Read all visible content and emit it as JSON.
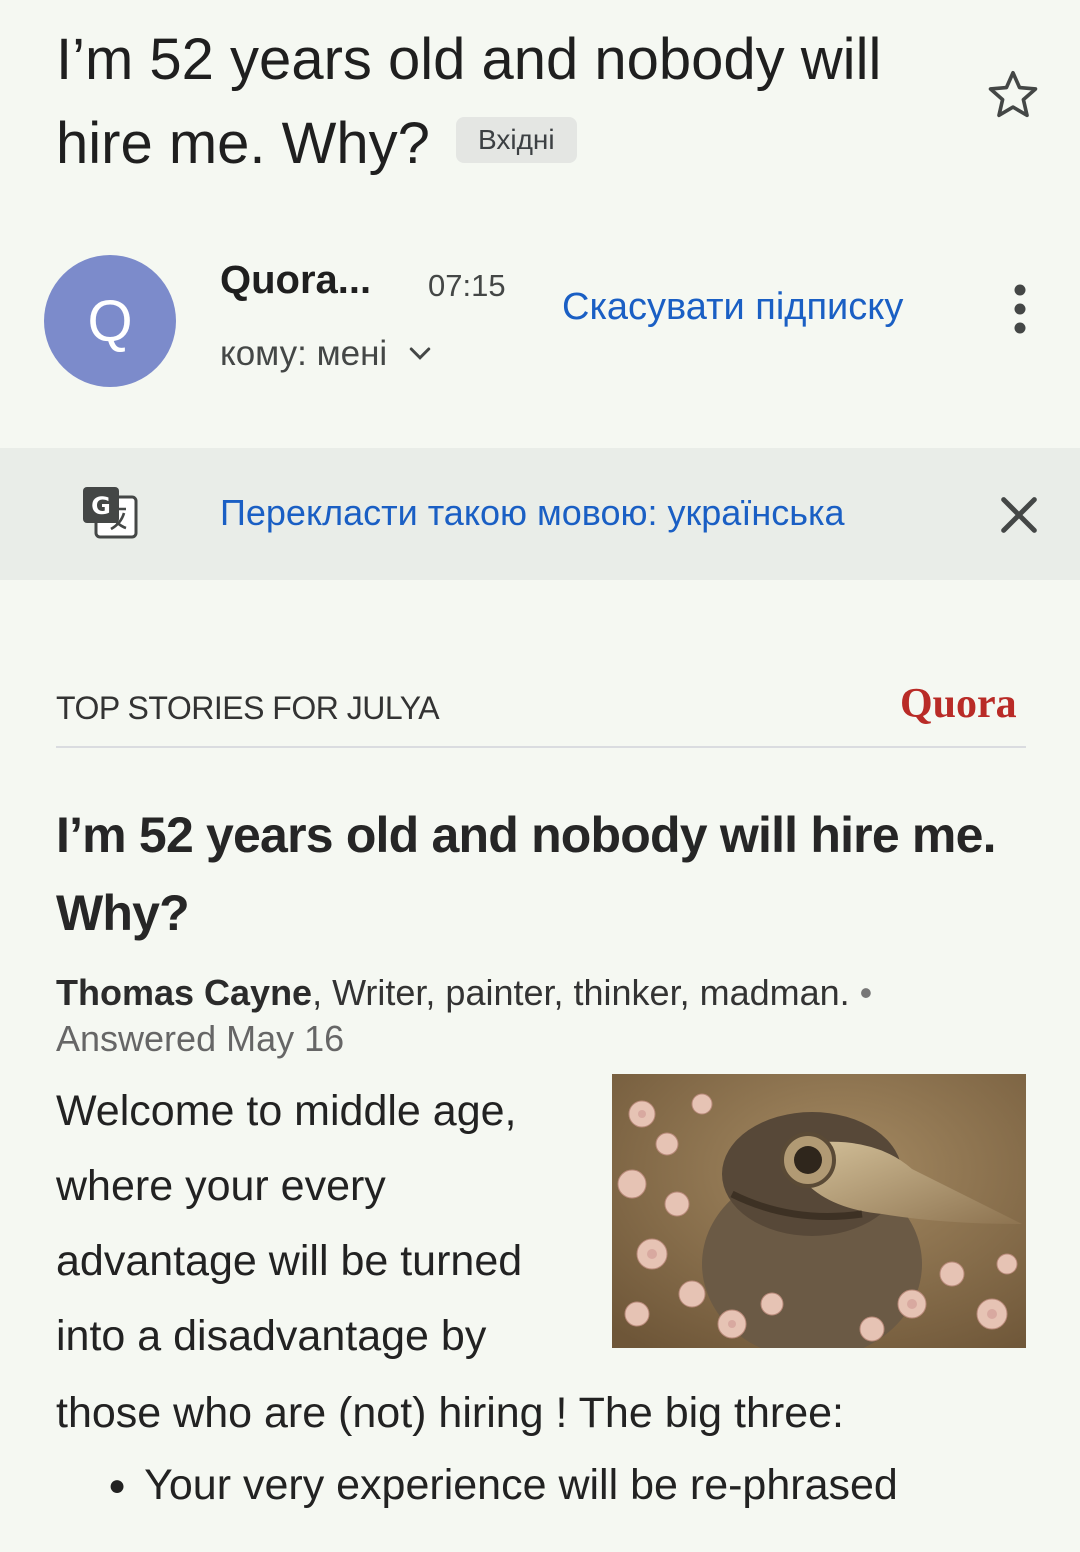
{
  "header": {
    "subject": "I’m 52 years old and nobody will hire me. Why?",
    "label": "Вхідні",
    "star_icon": "star-outline-icon"
  },
  "sender": {
    "avatar_letter": "Q",
    "avatar_color": "#7c8bcb",
    "name": "Quora...",
    "time": "07:15",
    "to": "кому: мені",
    "unsubscribe": "Скасувати підписку"
  },
  "translate": {
    "link": "Перекласти такою мовою: українська"
  },
  "email": {
    "top_stories": "TOP STORIES FOR JULYA",
    "logo": "Quora",
    "question_title": "I’m 52 years old and nobody will hire me. Why?",
    "author": "Thomas Cayne",
    "credential": ", Writer, painter, thinker, madman.",
    "separator": "•",
    "answered": "Answered May 16",
    "answer_wrapped": "Welcome to middle age, where your every advantage will be turned into a disadvantage by",
    "answer_line": "those who are (not) hiring ! The big three:",
    "bullets": [
      "Your very experience will be re-phrased"
    ]
  },
  "colors": {
    "background": "#f5f8f2",
    "link": "#1a5fc4",
    "quora_red": "#b92b27"
  }
}
